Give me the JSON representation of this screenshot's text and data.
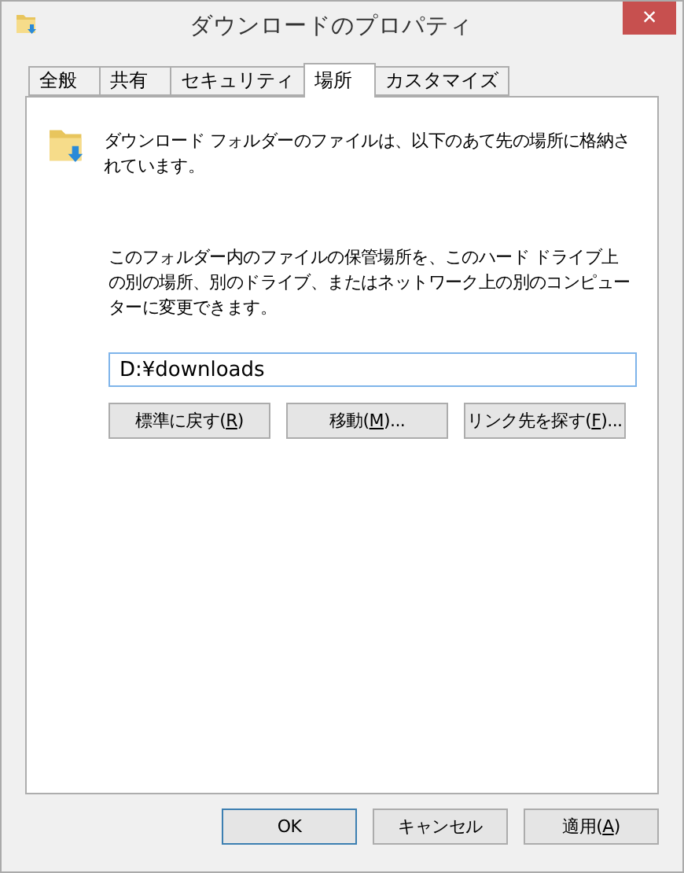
{
  "window": {
    "title": "ダウンロードのプロパティ",
    "close": "×"
  },
  "tabs": [
    {
      "label": "全般",
      "selected": false
    },
    {
      "label": "共有",
      "selected": false
    },
    {
      "label": "セキュリティ",
      "selected": false
    },
    {
      "label": "場所",
      "selected": true
    },
    {
      "label": "カスタマイズ",
      "selected": false
    }
  ],
  "header_text": "ダウンロード フォルダーのファイルは、以下のあて先の場所に格納されています。",
  "description": "このフォルダー内のファイルの保管場所を、このハード ドライブ上の別の場所、別のドライブ、またはネットワーク上の別のコンピューターに変更できます。",
  "path_field": {
    "value": "D:¥downloads"
  },
  "location_buttons": [
    {
      "before": "標準に戻す(",
      "key": "R",
      "after": ")"
    },
    {
      "before": "移動(",
      "key": "M",
      "after": ")..."
    },
    {
      "before": "リンク先を探す(",
      "key": "F",
      "after": ")..."
    }
  ],
  "dialog_buttons": [
    {
      "before": "OK",
      "default": true
    },
    {
      "before": "キャンセル",
      "default": false
    },
    {
      "before": "適用(",
      "key": "A",
      "after": ")",
      "default": false
    }
  ]
}
